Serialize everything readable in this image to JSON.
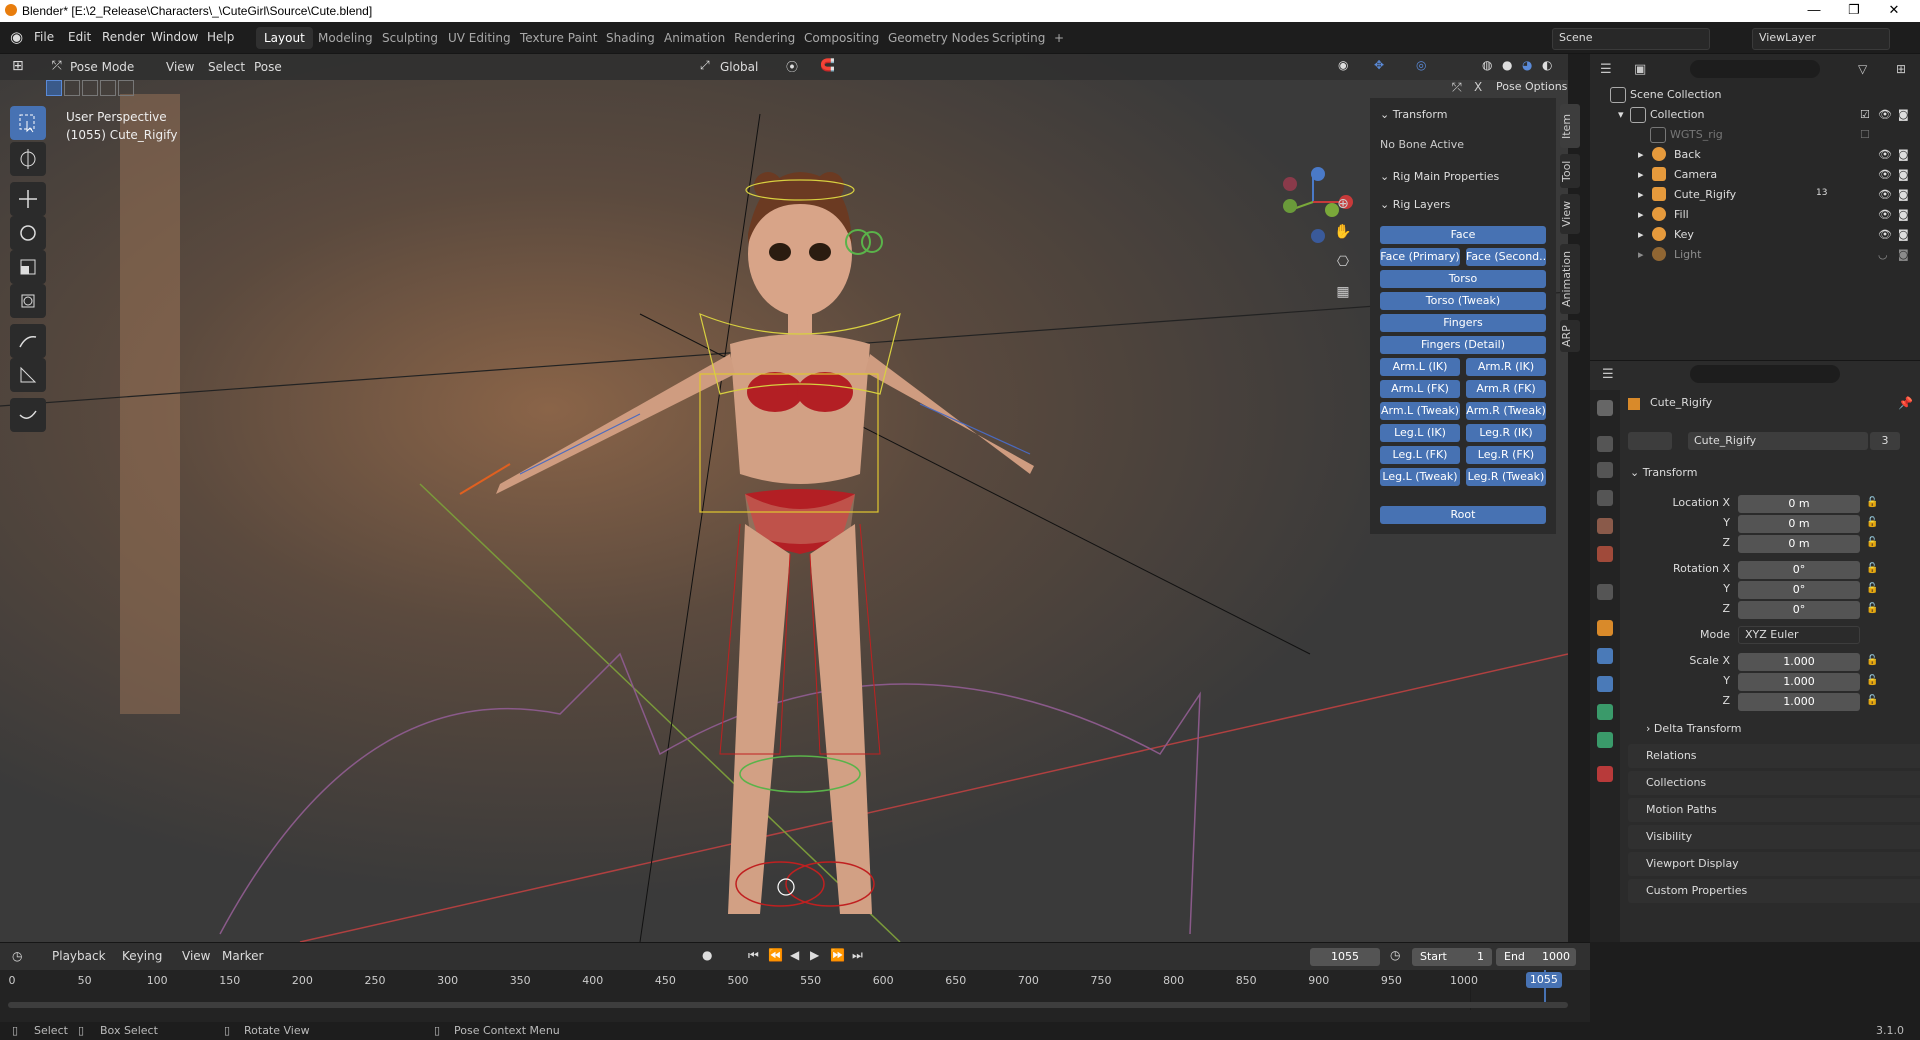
{
  "window": {
    "title": "Blender* [E:\\2_Release\\Characters\\_\\CuteGirl\\Source\\Cute.blend]",
    "min": "—",
    "max": "❐",
    "close": "✕"
  },
  "menu": [
    "File",
    "Edit",
    "Render",
    "Window",
    "Help"
  ],
  "workspaces": [
    "Layout",
    "Modeling",
    "Sculpting",
    "UV Editing",
    "Texture Paint",
    "Shading",
    "Animation",
    "Rendering",
    "Compositing",
    "Geometry Nodes",
    "Scripting",
    "+"
  ],
  "scene": {
    "label": "Scene",
    "viewlayer": "ViewLayer"
  },
  "viewport_header": {
    "mode": "Pose Mode",
    "menus": [
      "View",
      "Select",
      "Pose"
    ],
    "orientation": "Global",
    "pose_options": "Pose Options"
  },
  "overlay_text": {
    "line1": "User Perspective",
    "line2": "(1055) Cute_Rigify"
  },
  "npanel": {
    "tabs": [
      "Item",
      "Tool",
      "View",
      "Animation",
      "ARP"
    ],
    "transform_header": "Transform",
    "no_bone": "No Bone Active",
    "rig_main": "Rig Main Properties",
    "rig_layers": "Rig Layers",
    "buttons": {
      "face": "Face",
      "face_primary": "Face (Primary)",
      "face_second": "Face (Second...",
      "torso": "Torso",
      "torso_tweak": "Torso (Tweak)",
      "fingers": "Fingers",
      "fingers_detail": "Fingers (Detail)",
      "arm_l_ik": "Arm.L (IK)",
      "arm_r_ik": "Arm.R (IK)",
      "arm_l_fk": "Arm.L (FK)",
      "arm_r_fk": "Arm.R (FK)",
      "arm_l_tweak": "Arm.L (Tweak)",
      "arm_r_tweak": "Arm.R (Tweak)",
      "leg_l_ik": "Leg.L (IK)",
      "leg_r_ik": "Leg.R (IK)",
      "leg_l_fk": "Leg.L (FK)",
      "leg_r_fk": "Leg.R (FK)",
      "leg_l_tweak": "Leg.L (Tweak)",
      "leg_r_tweak": "Leg.R (Tweak)",
      "root": "Root"
    }
  },
  "outliner": {
    "rows": [
      {
        "label": "Scene Collection"
      },
      {
        "label": "Collection"
      },
      {
        "label": "WGTS_rig"
      },
      {
        "label": "Back"
      },
      {
        "label": "Camera"
      },
      {
        "label": "Cute_Rigify",
        "badge": "13"
      },
      {
        "label": "Fill"
      },
      {
        "label": "Key"
      },
      {
        "label": "Light"
      }
    ]
  },
  "properties": {
    "object_name": "Cute_Rigify",
    "data_name": "Cute_Rigify",
    "users": "3",
    "transform": "Transform",
    "location_x_label": "Location X",
    "y_label": "Y",
    "z_label": "Z",
    "location": [
      "0 m",
      "0 m",
      "0 m"
    ],
    "rotation_x_label": "Rotation X",
    "rotation": [
      "0°",
      "0°",
      "0°"
    ],
    "mode_label": "Mode",
    "mode": "XYZ Euler",
    "scale_x_label": "Scale X",
    "scale": [
      "1.000",
      "1.000",
      "1.000"
    ],
    "delta": "Delta Transform",
    "sections": [
      "Relations",
      "Collections",
      "Motion Paths",
      "Visibility",
      "Viewport Display",
      "Custom Properties"
    ]
  },
  "timeline": {
    "menus": [
      "Playback",
      "Keying",
      "View",
      "Marker"
    ],
    "current_frame": "1055",
    "start_label": "Start",
    "start": "1",
    "end_label": "End",
    "end": "1000",
    "ticks": [
      "0",
      "50",
      "100",
      "150",
      "200",
      "250",
      "300",
      "350",
      "400",
      "450",
      "500",
      "550",
      "600",
      "650",
      "700",
      "750",
      "800",
      "850",
      "900",
      "950",
      "1000"
    ],
    "playhead": "1055"
  },
  "status": {
    "select": "Select",
    "box_select": "Box Select",
    "rotate": "Rotate View",
    "context": "Pose Context Menu",
    "version": "3.1.0"
  }
}
